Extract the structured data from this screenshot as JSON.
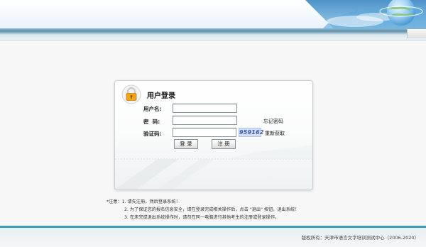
{
  "login": {
    "title": "用户登录",
    "username_label": "用户名:",
    "password_label": "密  码:",
    "captcha_label": "验证码:",
    "username_value": "",
    "password_value": "",
    "captcha_value": "",
    "captcha_code": "959162",
    "forgot_password": "忘记密码",
    "refresh_captcha": "重新获取",
    "login_button": "登 录",
    "register_button": "注 册"
  },
  "notes": {
    "line1": "*注意：1. 请先注册，然后登录系统！",
    "line2": "2. 为了保证您的报名信息安全，请在登录完成相关操作后，点击 \"退出\" 按钮，退出系统！",
    "line3": "3. 在未完成退出系统操作时，请勿在同一电脑进行其他考生的注册或登录操作。"
  },
  "footer": {
    "copyright": "版权所有：天津市语言文字培训测试中心（2006-2020）"
  },
  "colors": {
    "accent": "#3a9fb4",
    "nav_bar": "#5e8fab",
    "lock": "#f2a31b"
  },
  "icons": [
    "lock-icon",
    "globe-decoration"
  ]
}
